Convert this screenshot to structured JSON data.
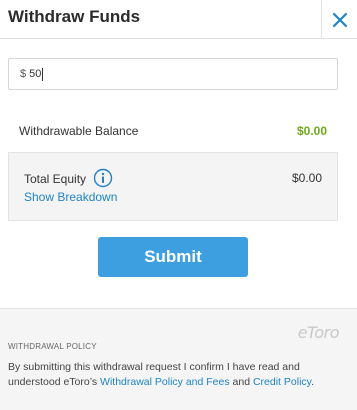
{
  "header": {
    "title": "Withdraw Funds",
    "close_icon": "close-icon"
  },
  "amount": {
    "currency": "$",
    "value": "50"
  },
  "balance": {
    "label": "Withdrawable Balance",
    "value": "$0.00"
  },
  "equity": {
    "label": "Total Equity",
    "value": "$0.00",
    "info_icon": "info-icon",
    "breakdown_link": "Show Breakdown"
  },
  "submit": {
    "label": "Submit"
  },
  "policy": {
    "title": "WITHDRAWAL POLICY",
    "logo_text": "eToro",
    "text_part1": "By submitting this withdrawal request I confirm I have read and understood eToro’s ",
    "link1": "Withdrawal Policy and Fees",
    "text_part2": " and ",
    "link2": "Credit Policy",
    "text_part3": "."
  },
  "colors": {
    "accent": "#3d9fe0",
    "link": "#1e83c8",
    "positive": "#6fa81f"
  }
}
